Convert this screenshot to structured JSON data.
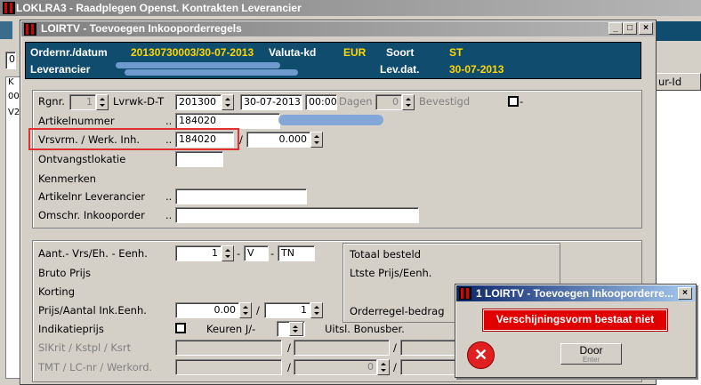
{
  "bg_window": {
    "title": "LOKLRA3 - Raadplegen Openst. Kontrakten Leverancier",
    "left_chars": [
      "L",
      "0",
      "K",
      "00",
      "V2"
    ],
    "col_header": "ur-Id"
  },
  "main_window": {
    "title": "LOIRTV - Toevoegen Inkooporderregels",
    "min": "_",
    "max": "□",
    "close": "×"
  },
  "header": {
    "ordernr_label": "Ordernr./datum",
    "ordernr_value": "20130730003/30-07-2013",
    "valuta_label": "Valuta-kd",
    "valuta_value": "EUR",
    "soort_label": "Soort",
    "soort_value": "ST",
    "leverancier_label": "Leverancier",
    "levdat_label": "Lev.dat.",
    "levdat_value": "30-07-2013"
  },
  "form1": {
    "rgnr_label": "Rgnr.",
    "rgnr_value": "1",
    "lvrwk_label": "Lvrwk-D-T",
    "lvrwk_week": "201300",
    "lvrwk_date": "30-07-2013",
    "lvrwk_time": "00:00",
    "dagen_label": "Dagen",
    "dagen_value": "0",
    "bevestigd_label": "Bevestigd",
    "bevestigd_dash": "-",
    "artikel_label": "Artikelnummer",
    "artikel_dots": "..",
    "artikel_value": "184020",
    "vrsvrm_label": "Vrsvrm. / Werk. Inh.",
    "vrsvrm_dots": "..",
    "vrsvrm_value": "184020",
    "werk_sep": "/",
    "werk_value": "0.000",
    "ontvang_label": "Ontvangstlokatie",
    "kenmerken_label": "Kenmerken",
    "artlev_label": "Artikelnr Leverancier",
    "artlev_dots": "..",
    "omschr_label": "Omschr. Inkooporder",
    "omschr_dots": ".."
  },
  "form2": {
    "aant_label": "Aant.- Vrs/Eh. - Eenh.",
    "aant_value": "1",
    "aant_sep1": "-",
    "aant_v": "V",
    "aant_sep2": "-",
    "aant_tn": "TN",
    "bruto_label": "Bruto Prijs",
    "korting_label": "Korting",
    "prijs_label": "Prijs/Aantal Ink.Eenh.",
    "prijs_value": "0.00",
    "prijs_sep": "/",
    "prijs_aantal": "1",
    "indic_label": "Indikatieprijs",
    "keuren_label": "Keuren J/-",
    "uitsl_label": "Uitsl. Bonusber.",
    "slkrit_label": "SlKrit / Kstpl / Ksrt",
    "tmt_label": "TMT / LC-nr / Werkord.",
    "tmt_value": "0",
    "totaal_label": "Totaal besteld",
    "ltste_label": "Ltste Prijs/Eenh.",
    "orderregel_label": "Orderregel-bedrag",
    "sep": "/"
  },
  "error_dialog": {
    "title": "1 LOIRTV - Toevoegen Inkooporderre...",
    "close": "×",
    "message": "Verschijningsvorm bestaat niet",
    "button_label": "Door",
    "button_sub": "Enter",
    "error_glyph": "✕"
  }
}
